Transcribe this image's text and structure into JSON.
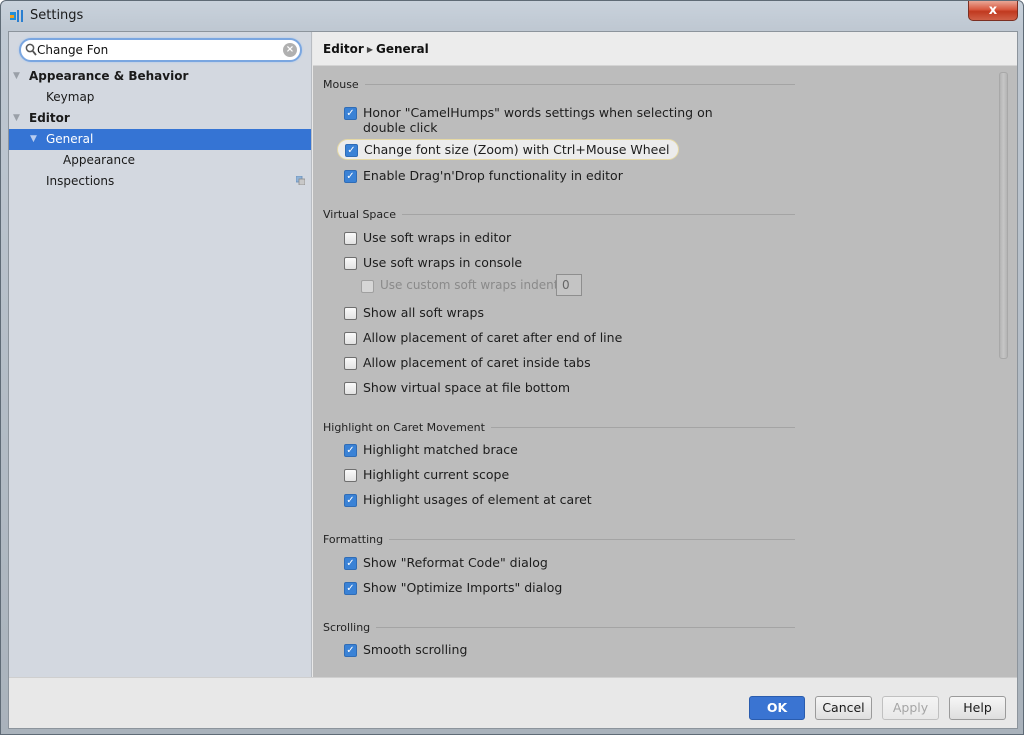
{
  "window": {
    "title": "Settings",
    "close_label": "x"
  },
  "search": {
    "value": "Change Fon",
    "clear_label": "×"
  },
  "tree": [
    {
      "label": "Appearance & Behavior",
      "level": 0,
      "expanded": true,
      "bold": true
    },
    {
      "label": "Keymap",
      "level": 1
    },
    {
      "label": "Editor",
      "level": 0,
      "expanded": true,
      "bold": true
    },
    {
      "label": "General",
      "level": 1,
      "expanded": true,
      "selected": true
    },
    {
      "label": "Appearance",
      "level": 2
    },
    {
      "label": "Inspections",
      "level": 1,
      "has_copy_icon": true
    }
  ],
  "breadcrumb": {
    "parent": "Editor",
    "separator": "▶",
    "current": "General"
  },
  "groups": {
    "mouse": {
      "title": "Mouse",
      "options": [
        {
          "label": "Honor \"CamelHumps\" words settings when selecting on",
          "label2": "double click",
          "checked": true
        },
        {
          "label": "Change font size (Zoom) with Ctrl+Mouse Wheel",
          "checked": true,
          "highlighted": true
        },
        {
          "label": "Enable Drag'n'Drop functionality in editor",
          "checked": true
        }
      ]
    },
    "virtual_space": {
      "title": "Virtual Space",
      "options": [
        {
          "label": "Use soft wraps in editor",
          "checked": false
        },
        {
          "label": "Use soft wraps in console",
          "checked": false
        },
        {
          "label": "Use custom soft wraps indent",
          "checked": false,
          "disabled": true,
          "value": "0"
        },
        {
          "label": "Show all soft wraps",
          "checked": false
        },
        {
          "label": "Allow placement of caret after end of line",
          "checked": false
        },
        {
          "label": "Allow placement of caret inside tabs",
          "checked": false
        },
        {
          "label": "Show virtual space at file bottom",
          "checked": false
        }
      ]
    },
    "highlight": {
      "title": "Highlight on Caret Movement",
      "options": [
        {
          "label": "Highlight matched brace",
          "checked": true
        },
        {
          "label": "Highlight current scope",
          "checked": false
        },
        {
          "label": "Highlight usages of element at caret",
          "checked": true
        }
      ]
    },
    "formatting": {
      "title": "Formatting",
      "options": [
        {
          "label": "Show \"Reformat Code\" dialog",
          "checked": true
        },
        {
          "label": "Show \"Optimize Imports\" dialog",
          "checked": true
        }
      ]
    },
    "scrolling": {
      "title": "Scrolling",
      "options": [
        {
          "label": "Smooth scrolling",
          "checked": true
        }
      ]
    }
  },
  "buttons": {
    "ok": "OK",
    "cancel": "Cancel",
    "apply": "Apply",
    "help": "Help"
  },
  "colors": {
    "accent": "#3574d4",
    "checkbox_on": "#3a82d6",
    "close": "#c9432a"
  },
  "check_glyph": "✓"
}
